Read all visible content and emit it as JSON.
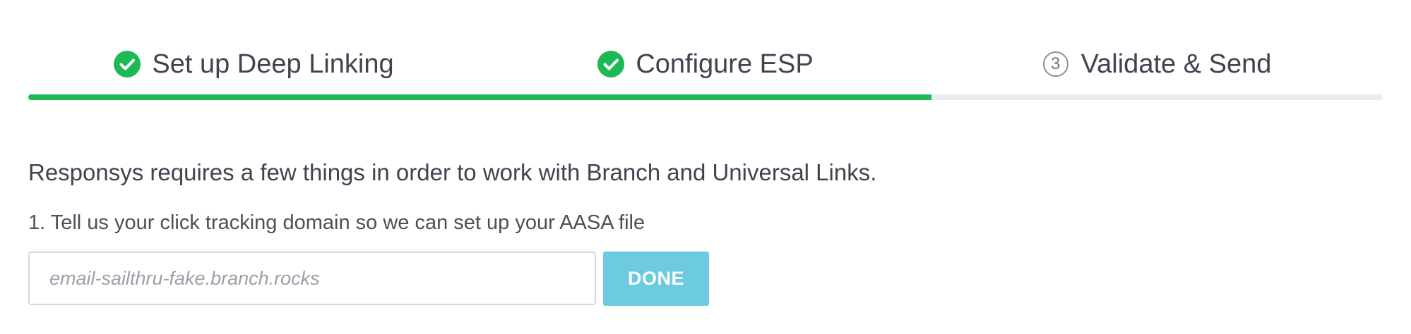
{
  "stepper": {
    "progress_fraction": 0.667,
    "complete_color": "#1db954",
    "incomplete_color": "#eaecef",
    "steps": [
      {
        "label": "Set up Deep Linking",
        "status": "complete",
        "icon": "check-circle-icon"
      },
      {
        "label": "Configure ESP",
        "status": "complete",
        "icon": "check-circle-icon"
      },
      {
        "label": "Validate & Send",
        "status": "current",
        "number": "3",
        "icon": "number-circle-icon"
      }
    ]
  },
  "main": {
    "heading": "Responsys requires a few things in order to work with Branch and Universal Links.",
    "instruction": "1. Tell us your click tracking domain so we can set up your AASA file",
    "domain_input": {
      "value": "",
      "placeholder": "email-sailthru-fake.branch.rocks"
    },
    "done_button": {
      "label": "DONE",
      "color": "#6ccbe0"
    }
  }
}
